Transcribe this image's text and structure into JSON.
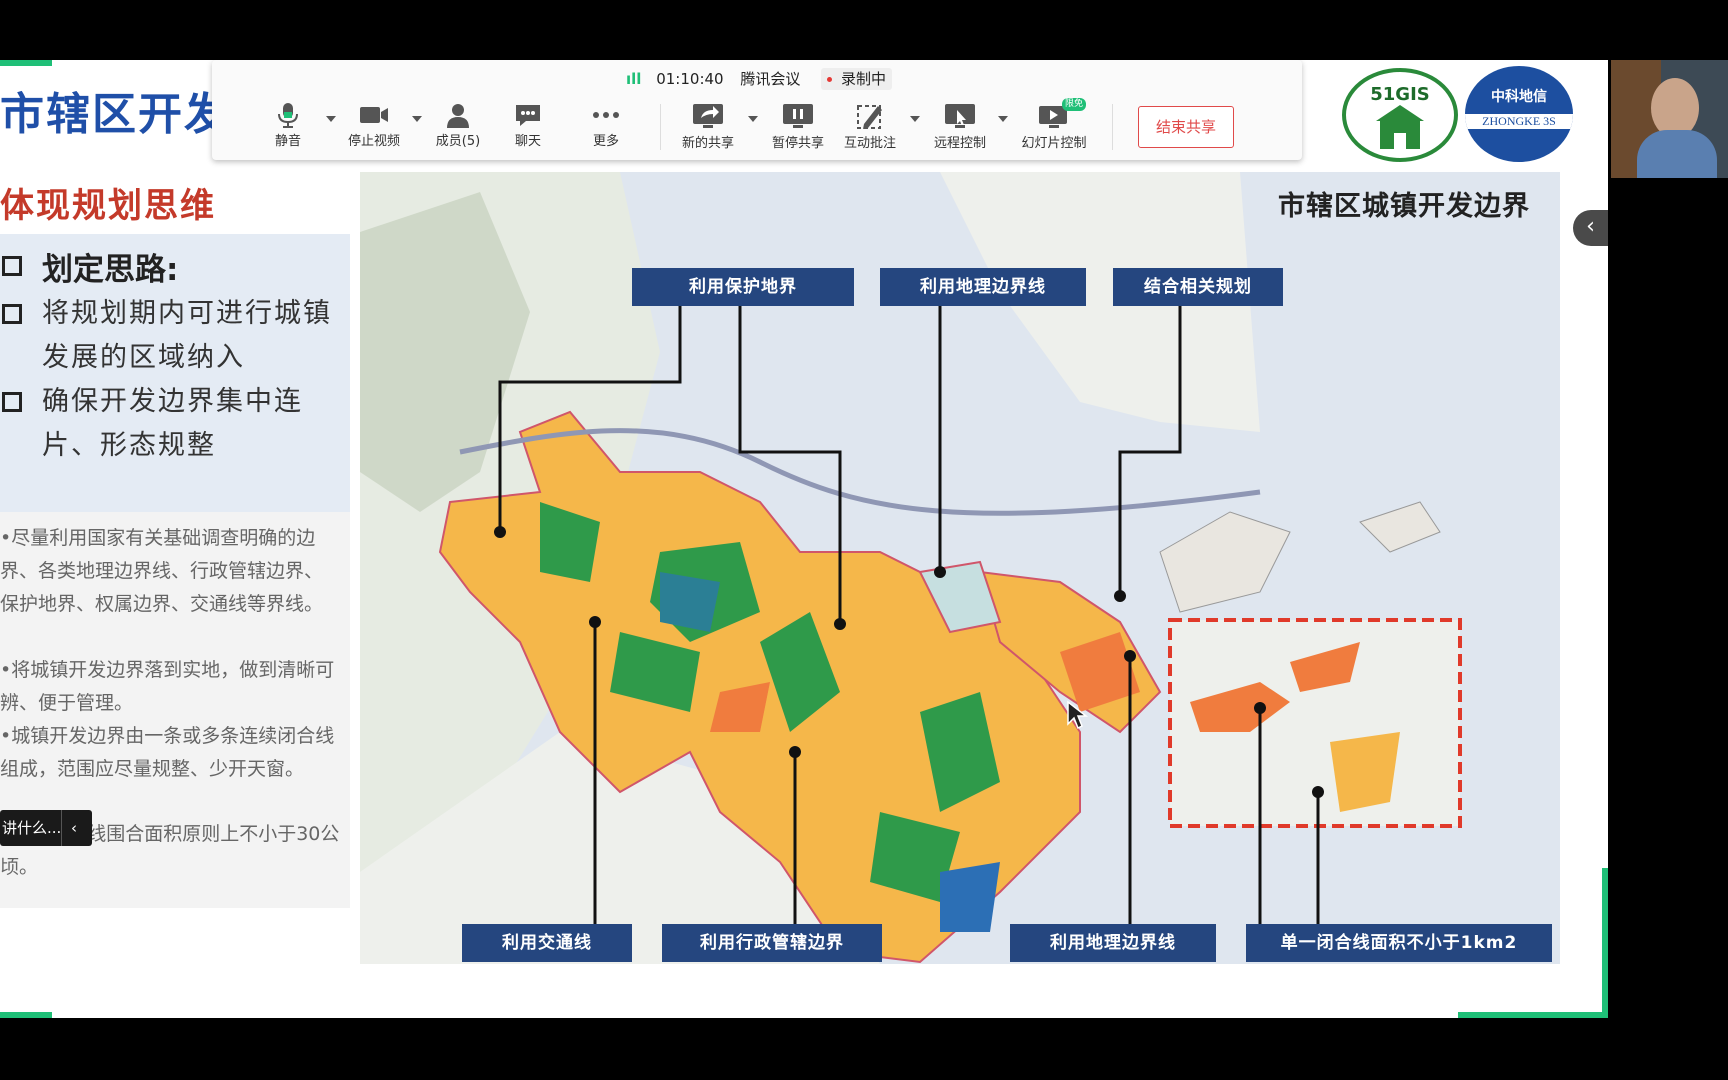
{
  "toolbar": {
    "signal": "ıll",
    "time": "01:10:40",
    "app_name": "腾讯会议",
    "recording": "录制中",
    "buttons": {
      "mute": "静音",
      "stop_video": "停止视频",
      "members": "成员(5)",
      "chat": "聊天",
      "more": "更多",
      "new_share": "新的共享",
      "pause_share": "暂停共享",
      "annotate": "互动批注",
      "remote_control": "远程控制",
      "slideshow": "幻灯片控制",
      "slideshow_badge": "限免"
    },
    "end_share": "结束共享"
  },
  "slide": {
    "title": "市辖区开发",
    "section_heading": "体现规划思维",
    "bullets": [
      "划定思路:",
      "将规划期内可进行城镇发展的区域纳入",
      "确保开发边界集中连片、形态规整"
    ],
    "notes": [
      {
        "bold": "",
        "text": "•尽量利用国家有关基础调查明确的边界、各类地理边界线、行政管辖边界、保护地界、权属边界、交通线等界线。"
      },
      {
        "bold": "",
        "text": "•将城镇开发边界落到实地，做到清晰可辨、便于管理。"
      },
      {
        "bold": "",
        "text": "•城镇开发边界由一条或多条连续闭合线组成，范围应尽量规整、少开天窗。"
      },
      {
        "bold": "",
        "text": "•单一闭合线围合面积原则上不小于30公顷。"
      }
    ],
    "map_title": "市辖区城镇开发边界",
    "callouts": {
      "protect": "利用保护地界",
      "geo_top": "利用地理边界线",
      "related": "结合相关规划",
      "traffic": "利用交通线",
      "admin": "利用行政管辖边界",
      "geo_bottom": "利用地理边界线",
      "closed": "单一闭合线面积不小于1km2"
    },
    "logo_51gis": "51GIS",
    "logo_zhongke_cn": "中科地信",
    "logo_zhongke_en": "ZHONGKE 3S"
  },
  "popup": {
    "label": "讲什么...",
    "collapse": "‹"
  },
  "side_collapse": "‹",
  "colors": {
    "slide_title": "#1f4fa8",
    "heading": "#c43a2a",
    "callout_bg": "#25467f",
    "land_orange": "#f5b74a",
    "land_green": "#2f9a4a",
    "sea": "#dfe6ef",
    "recording_red": "#e53935",
    "accent_green": "#1fbf77"
  }
}
